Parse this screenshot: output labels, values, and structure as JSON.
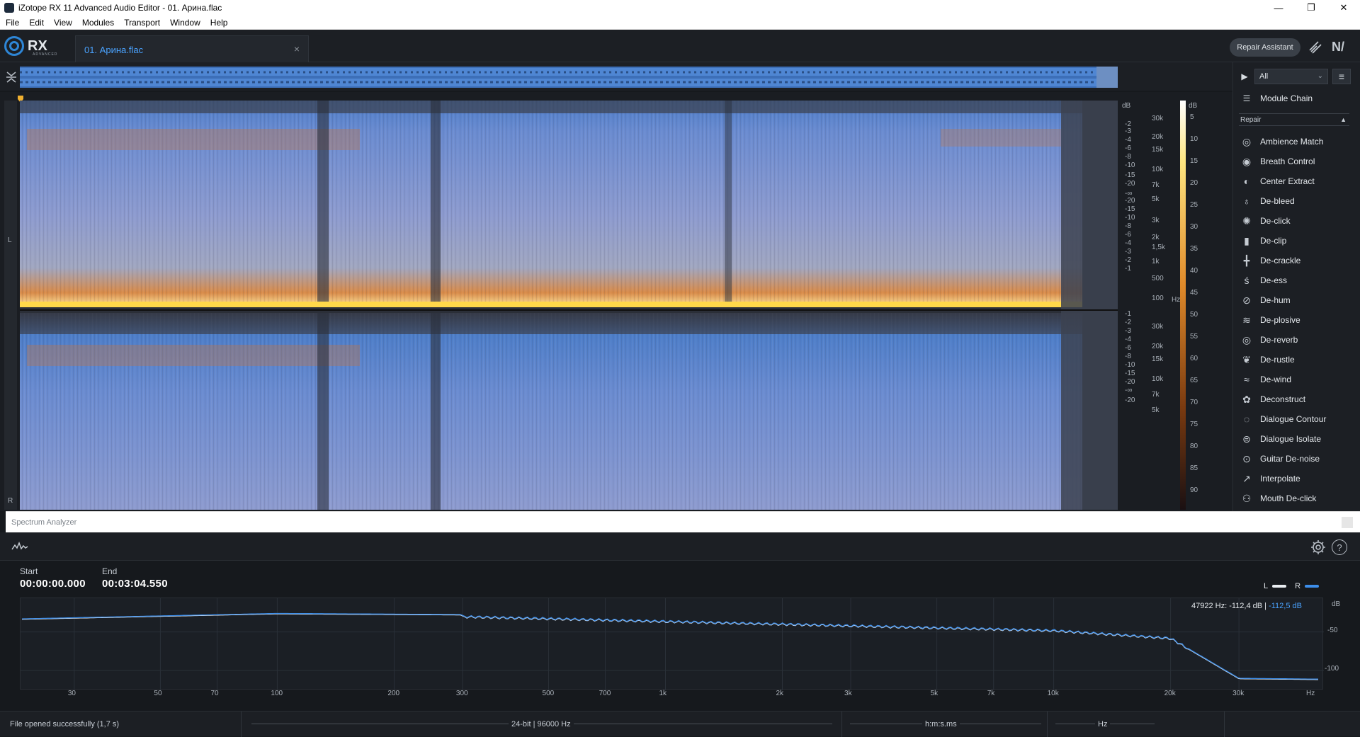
{
  "window": {
    "title": "iZotope RX 11 Advanced Audio Editor - 01. Арина.flac",
    "controls": [
      "—",
      "❐",
      "✕"
    ]
  },
  "menu": [
    "File",
    "Edit",
    "View",
    "Modules",
    "Transport",
    "Window",
    "Help"
  ],
  "header": {
    "logo_text": "RX",
    "logo_sub": "ADVANCED",
    "file_tab": "01. Арина.flac",
    "file_tab_close": "×",
    "repair_assistant": "Repair Assistant",
    "ni_logo": "N/"
  },
  "spectrogram": {
    "channels": [
      "L",
      "R"
    ],
    "db_scale_unit": "dB",
    "db_ticks_L": [
      "-2",
      "-3",
      "-4",
      "-6",
      "-8",
      "-10",
      "-15",
      "-20",
      "-∞",
      "-20",
      "-15",
      "-10",
      "-8",
      "-6",
      "-4",
      "-3",
      "-2",
      "-1"
    ],
    "db_ticks_R": [
      "-1",
      "-2",
      "-3",
      "-4",
      "-6",
      "-8",
      "-10",
      "-15",
      "-20",
      "-∞",
      "-20"
    ],
    "hz_ticks_L": [
      "30k",
      "20k",
      "15k",
      "10k",
      "7k",
      "5k",
      "3k",
      "2k",
      "1,5k",
      "1k",
      "500",
      "100"
    ],
    "hz_unit": "Hz",
    "hz_ticks_R": [
      "30k",
      "20k",
      "15k",
      "10k",
      "7k",
      "5k"
    ],
    "color_scale_unit": "dB",
    "color_ticks": [
      "5",
      "10",
      "15",
      "20",
      "25",
      "30",
      "35",
      "40",
      "45",
      "50",
      "55",
      "60",
      "65",
      "70",
      "75",
      "80",
      "85",
      "90"
    ]
  },
  "modules": {
    "filter": "All",
    "module_chain": "Module Chain",
    "category": "Repair",
    "items": [
      {
        "label": "Ambience Match",
        "icon": "ambience-match-icon"
      },
      {
        "label": "Breath Control",
        "icon": "breath-control-icon"
      },
      {
        "label": "Center Extract",
        "icon": "center-extract-icon"
      },
      {
        "label": "De-bleed",
        "icon": "de-bleed-icon"
      },
      {
        "label": "De-click",
        "icon": "de-click-icon"
      },
      {
        "label": "De-clip",
        "icon": "de-clip-icon"
      },
      {
        "label": "De-crackle",
        "icon": "de-crackle-icon"
      },
      {
        "label": "De-ess",
        "icon": "de-ess-icon"
      },
      {
        "label": "De-hum",
        "icon": "de-hum-icon"
      },
      {
        "label": "De-plosive",
        "icon": "de-plosive-icon"
      },
      {
        "label": "De-reverb",
        "icon": "de-reverb-icon"
      },
      {
        "label": "De-rustle",
        "icon": "de-rustle-icon"
      },
      {
        "label": "De-wind",
        "icon": "de-wind-icon"
      },
      {
        "label": "Deconstruct",
        "icon": "deconstruct-icon"
      },
      {
        "label": "Dialogue Contour",
        "icon": "dialogue-contour-icon"
      },
      {
        "label": "Dialogue Isolate",
        "icon": "dialogue-isolate-icon"
      },
      {
        "label": "Guitar De-noise",
        "icon": "guitar-de-noise-icon"
      },
      {
        "label": "Interpolate",
        "icon": "interpolate-icon"
      },
      {
        "label": "Mouth De-click",
        "icon": "mouth-de-click-icon"
      }
    ]
  },
  "spectrum_analyzer": {
    "title": "Spectrum Analyzer",
    "start_label": "Start",
    "start_value": "00:00:00.000",
    "end_label": "End",
    "end_value": "00:03:04.550",
    "legend_L": "L",
    "legend_R": "R",
    "readout_freq": "47922 Hz:",
    "readout_L": "-112,4 dB",
    "readout_sep": "|",
    "readout_R": "-112,5 dB",
    "db_unit": "dB",
    "db_ticks": [
      "-50",
      "-100"
    ],
    "hz_ticks": [
      "30",
      "50",
      "70",
      "100",
      "200",
      "300",
      "500",
      "700",
      "1k",
      "2k",
      "3k",
      "5k",
      "7k",
      "10k",
      "20k",
      "30k",
      "Hz"
    ],
    "colors": {
      "L": "#e9edf1",
      "R": "#3d8eea"
    }
  },
  "status": {
    "message": "File opened successfully (1,7 s)",
    "format": "24-bit | 96000 Hz",
    "time_format": "h:m:s.ms",
    "freq_unit": "Hz"
  }
}
